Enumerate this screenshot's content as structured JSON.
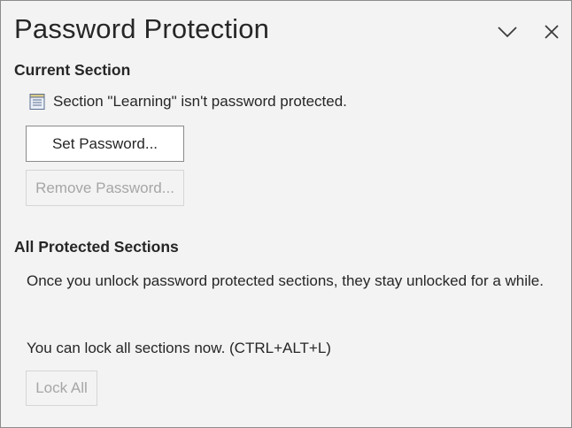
{
  "header": {
    "title": "Password Protection",
    "collapse_icon": "chevron-down-icon",
    "close_icon": "close-icon"
  },
  "current_section": {
    "heading": "Current Section",
    "status_icon": "notebook-section-icon",
    "status_text": "Section \"Learning\" isn't password protected.",
    "set_password_label": "Set Password...",
    "remove_password_label": "Remove Password..."
  },
  "all_sections": {
    "heading": "All Protected Sections",
    "info_text": "Once you unlock password protected sections, they stay unlocked for a while.",
    "lock_hint": "You can lock all sections now. (CTRL+ALT+L)",
    "lock_all_label": "Lock All"
  },
  "colors": {
    "pane_background": "#f3f3f3",
    "text": "#262626",
    "disabled_text": "#a6a6a6",
    "button_border": "#8a8a8a"
  }
}
